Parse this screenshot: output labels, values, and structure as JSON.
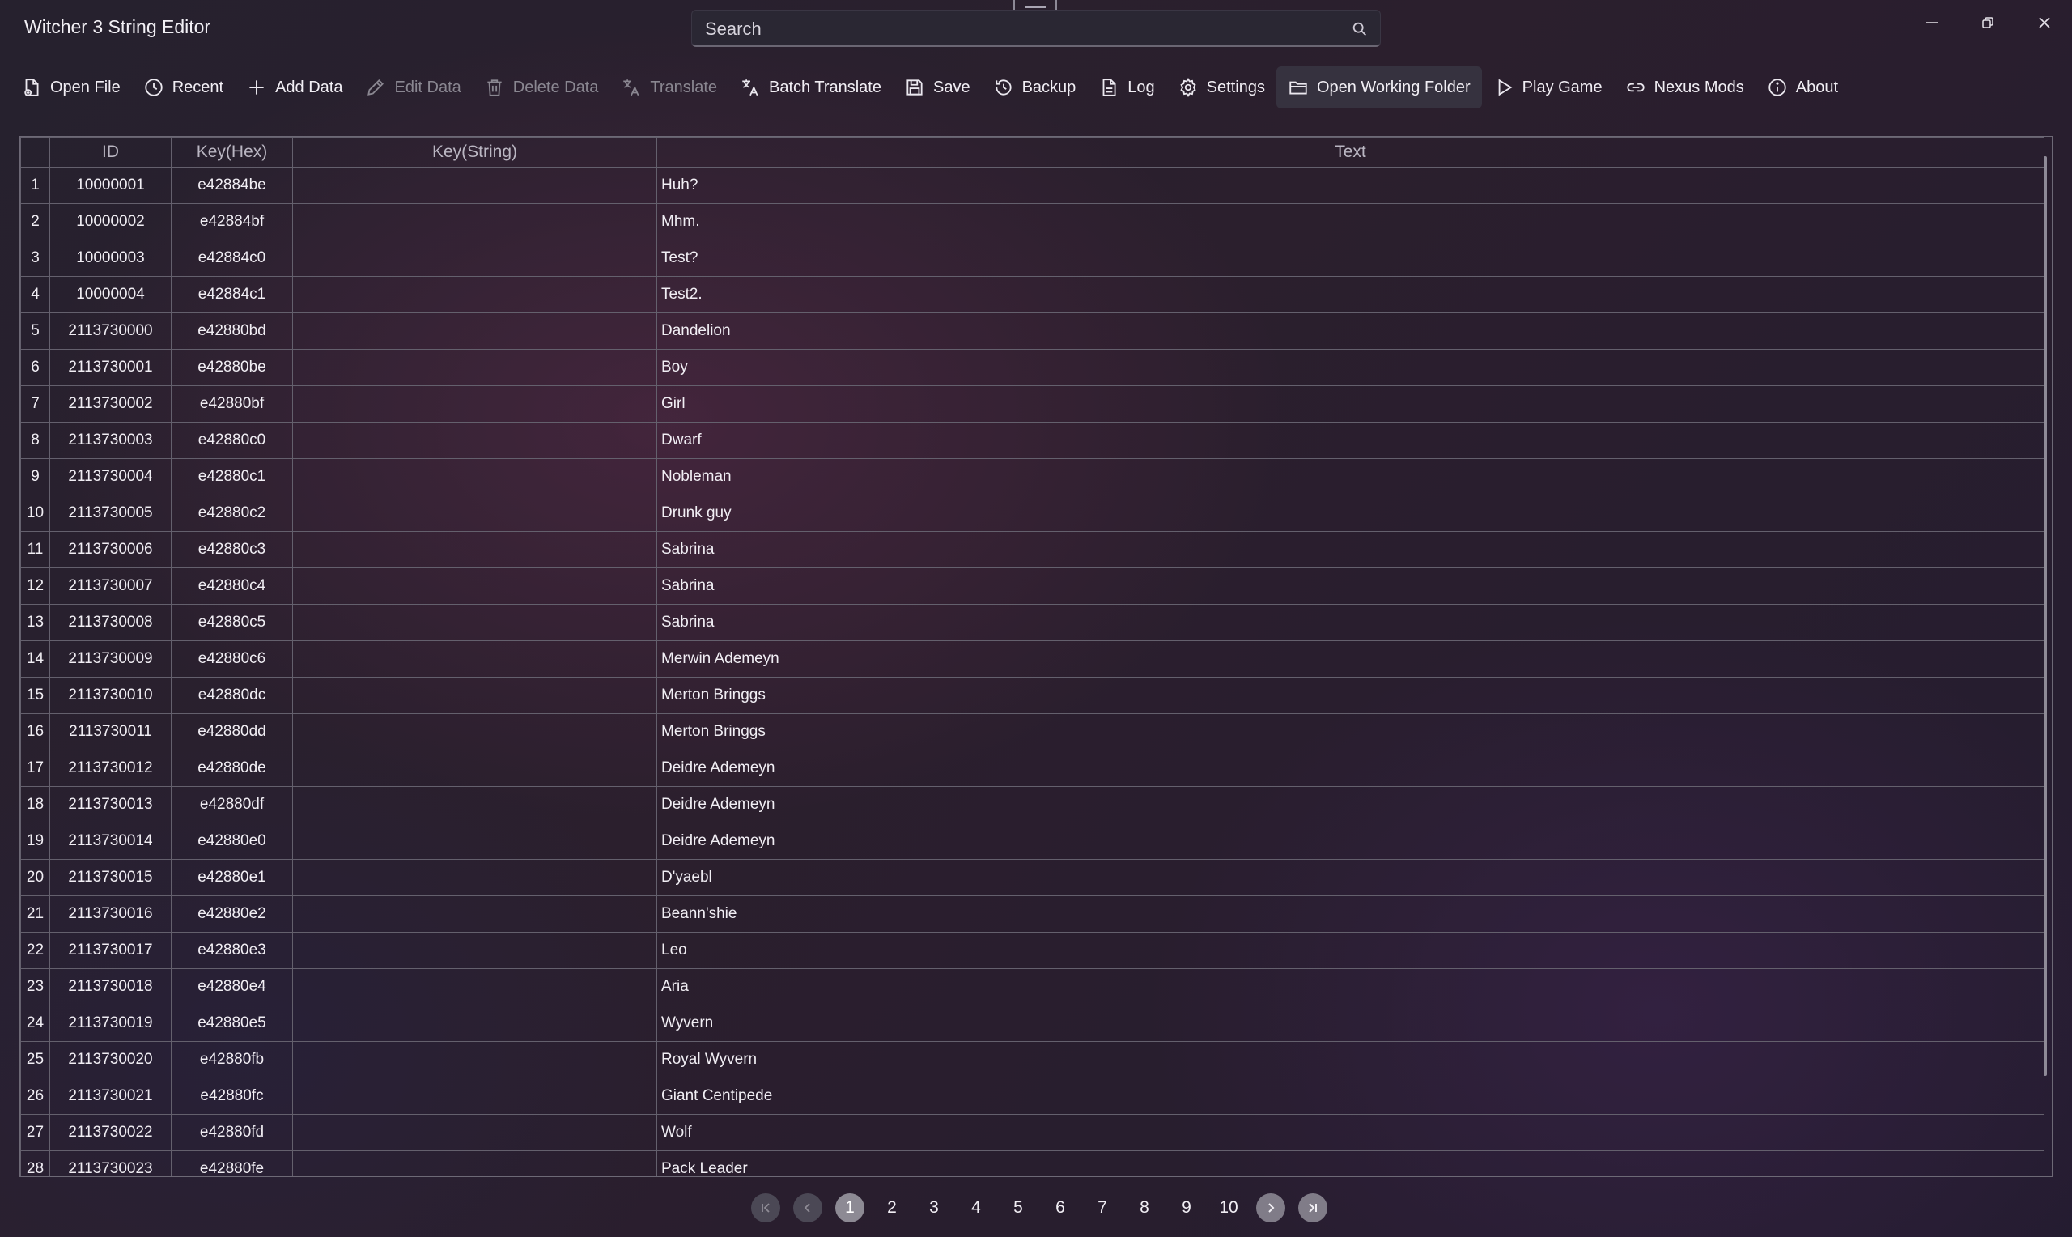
{
  "app": {
    "title": "Witcher 3 String Editor"
  },
  "search": {
    "placeholder": "Search"
  },
  "toolbar": {
    "open_file": "Open File",
    "recent": "Recent",
    "add_data": "Add Data",
    "edit_data": "Edit Data",
    "delete_data": "Delete Data",
    "translate": "Translate",
    "batch_translate": "Batch Translate",
    "save": "Save",
    "backup": "Backup",
    "log": "Log",
    "settings": "Settings",
    "open_working_folder": "Open Working Folder",
    "play_game": "Play Game",
    "nexus_mods": "Nexus Mods",
    "about": "About"
  },
  "grid": {
    "columns": [
      "",
      "ID",
      "Key(Hex)",
      "Key(String)",
      "Text"
    ],
    "rows": [
      [
        "1",
        "10000001",
        "e42884be",
        "",
        "Huh?"
      ],
      [
        "2",
        "10000002",
        "e42884bf",
        "",
        "Mhm."
      ],
      [
        "3",
        "10000003",
        "e42884c0",
        "",
        "Test?"
      ],
      [
        "4",
        "10000004",
        "e42884c1",
        "",
        "Test2."
      ],
      [
        "5",
        "2113730000",
        "e42880bd",
        "",
        "Dandelion"
      ],
      [
        "6",
        "2113730001",
        "e42880be",
        "",
        "Boy"
      ],
      [
        "7",
        "2113730002",
        "e42880bf",
        "",
        "Girl"
      ],
      [
        "8",
        "2113730003",
        "e42880c0",
        "",
        "Dwarf"
      ],
      [
        "9",
        "2113730004",
        "e42880c1",
        "",
        "Nobleman"
      ],
      [
        "10",
        "2113730005",
        "e42880c2",
        "",
        "Drunk guy"
      ],
      [
        "11",
        "2113730006",
        "e42880c3",
        "",
        "Sabrina"
      ],
      [
        "12",
        "2113730007",
        "e42880c4",
        "",
        "Sabrina"
      ],
      [
        "13",
        "2113730008",
        "e42880c5",
        "",
        "Sabrina"
      ],
      [
        "14",
        "2113730009",
        "e42880c6",
        "",
        "Merwin Ademeyn"
      ],
      [
        "15",
        "2113730010",
        "e42880dc",
        "",
        "Merton Bringgs"
      ],
      [
        "16",
        "2113730011",
        "e42880dd",
        "",
        "Merton Bringgs"
      ],
      [
        "17",
        "2113730012",
        "e42880de",
        "",
        "Deidre Ademeyn"
      ],
      [
        "18",
        "2113730013",
        "e42880df",
        "",
        "Deidre Ademeyn"
      ],
      [
        "19",
        "2113730014",
        "e42880e0",
        "",
        "Deidre Ademeyn"
      ],
      [
        "20",
        "2113730015",
        "e42880e1",
        "",
        "D'yaebl"
      ],
      [
        "21",
        "2113730016",
        "e42880e2",
        "",
        "Beann'shie"
      ],
      [
        "22",
        "2113730017",
        "e42880e3",
        "",
        "Leo"
      ],
      [
        "23",
        "2113730018",
        "e42880e4",
        "",
        "Aria"
      ],
      [
        "24",
        "2113730019",
        "e42880e5",
        "",
        "Wyvern"
      ],
      [
        "25",
        "2113730020",
        "e42880fb",
        "",
        "Royal Wyvern"
      ],
      [
        "26",
        "2113730021",
        "e42880fc",
        "",
        "Giant Centipede"
      ],
      [
        "27",
        "2113730022",
        "e42880fd",
        "",
        "Wolf"
      ],
      [
        "28",
        "2113730023",
        "e42880fe",
        "",
        "Pack Leader"
      ]
    ]
  },
  "pagination": {
    "pages": [
      "1",
      "2",
      "3",
      "4",
      "5",
      "6",
      "7",
      "8",
      "9",
      "10"
    ],
    "current": "1"
  }
}
